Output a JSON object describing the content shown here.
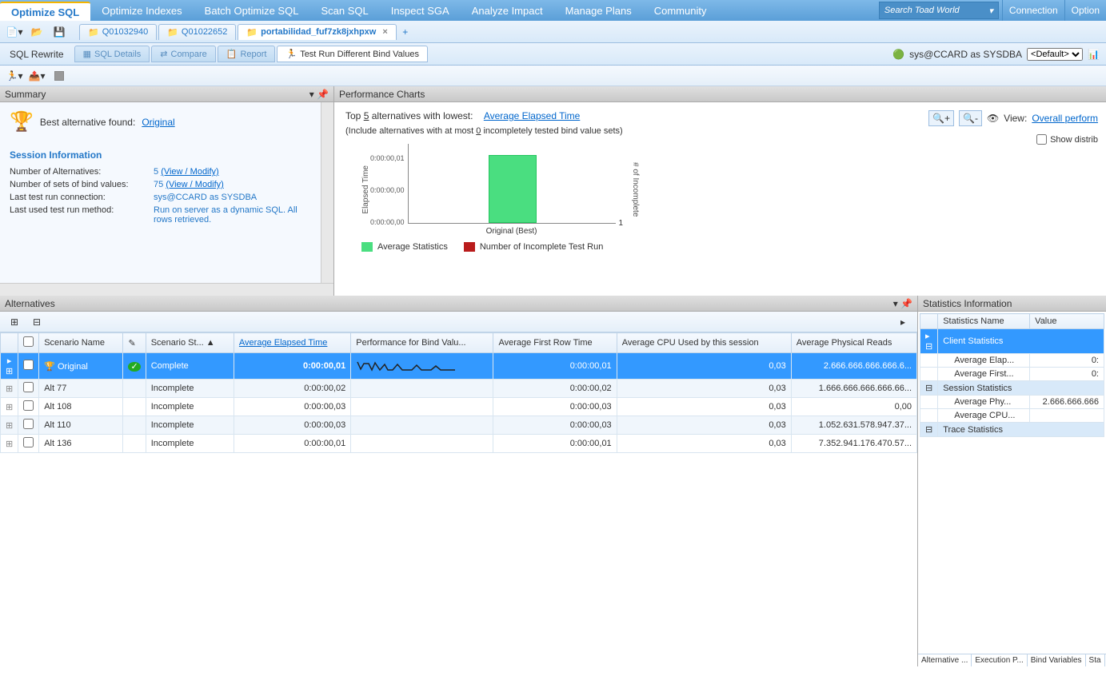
{
  "top_nav": {
    "tabs": [
      "Optimize SQL",
      "Optimize Indexes",
      "Batch Optimize SQL",
      "Scan SQL",
      "Inspect SGA",
      "Analyze Impact",
      "Manage Plans",
      "Community"
    ],
    "search_placeholder": "Search Toad World",
    "connection": "Connection",
    "options": "Option"
  },
  "doc_tabs": [
    "Q01032940",
    "Q01022652",
    "portabilidad_fuf7zk8jxhpxw"
  ],
  "sub_nav": {
    "rewrite": "SQL Rewrite",
    "tabs": [
      "SQL Details",
      "Compare",
      "Report",
      "Test Run Different Bind Values"
    ],
    "conn_text": "sys@CCARD as SYSDBA",
    "conn_select": "<Default>"
  },
  "summary": {
    "title": "Summary",
    "best_label": "Best alternative found:",
    "best_link": "Original",
    "session_title": "Session Information",
    "rows": [
      {
        "lbl": "Number of Alternatives:",
        "val": "5",
        "link": "(View / Modify)"
      },
      {
        "lbl": "Number of sets of bind values:",
        "val": "75",
        "link": "(View / Modify)"
      },
      {
        "lbl": "Last test run connection:",
        "val": "sys@CCARD as SYSDBA",
        "link": ""
      },
      {
        "lbl": "Last used test run method:",
        "val": "Run on server as a dynamic SQL. All rows retrieved.",
        "link": ""
      }
    ]
  },
  "charts": {
    "title": "Performance Charts",
    "filter_top": "Top",
    "filter_top_n": "5",
    "filter_text": "alternatives with lowest:",
    "filter_metric": "Average Elapsed Time",
    "include_text1": "(Include alternatives with at most",
    "include_n": "0",
    "include_text2": "incompletely tested bind value sets)",
    "view_label": "View:",
    "view_link": "Overall perform",
    "show_distrib": "Show distrib",
    "y_label": "Elapsed Time",
    "y_ticks": [
      "0:00:00,01",
      "0:00:00,00",
      "0:00:00,00"
    ],
    "x_label": "Original (Best)",
    "right_label": "# of Incomplete",
    "right_tick": "1",
    "legend": [
      {
        "color": "#4ade80",
        "text": "Average Statistics"
      },
      {
        "color": "#b91c1c",
        "text": "Number of Incomplete Test Run"
      }
    ]
  },
  "chart_data": {
    "type": "bar",
    "categories": [
      "Original (Best)"
    ],
    "series": [
      {
        "name": "Average Statistics",
        "values": [
          0.01
        ],
        "axis": "left"
      },
      {
        "name": "Number of Incomplete Test Run",
        "values": [
          0
        ],
        "axis": "right"
      }
    ],
    "ylabel_left": "Elapsed Time",
    "ylabel_right": "# of Incomplete",
    "ylim_left": [
      0,
      0.01
    ],
    "yticks_left": [
      "0:00:00,00",
      "0:00:00,00",
      "0:00:00,01"
    ],
    "ylim_right": [
      0,
      1
    ]
  },
  "alternatives": {
    "title": "Alternatives",
    "columns": [
      "",
      "",
      "Scenario Name",
      "",
      "Scenario St...",
      "Average Elapsed Time",
      "Performance for Bind Valu...",
      "Average First Row Time",
      "Average CPU Used by this session",
      "Average Physical Reads"
    ],
    "rows": [
      {
        "sel": true,
        "name": "Original",
        "status": "Complete",
        "elapsed": "0:00:00,01",
        "firstrow": "0:00:00,01",
        "cpu": "0,03",
        "reads": "2.666.666.666.666.6...",
        "check": true
      },
      {
        "sel": false,
        "name": "Alt 77",
        "status": "Incomplete",
        "elapsed": "0:00:00,02",
        "firstrow": "0:00:00,02",
        "cpu": "0,03",
        "reads": "1.666.666.666.666.66..."
      },
      {
        "sel": false,
        "name": "Alt 108",
        "status": "Incomplete",
        "elapsed": "0:00:00,03",
        "firstrow": "0:00:00,03",
        "cpu": "0,03",
        "reads": "0,00"
      },
      {
        "sel": false,
        "name": "Alt 110",
        "status": "Incomplete",
        "elapsed": "0:00:00,03",
        "firstrow": "0:00:00,03",
        "cpu": "0,03",
        "reads": "1.052.631.578.947.37..."
      },
      {
        "sel": false,
        "name": "Alt 136",
        "status": "Incomplete",
        "elapsed": "0:00:00,01",
        "firstrow": "0:00:00,01",
        "cpu": "0,03",
        "reads": "7.352.941.176.470.57..."
      }
    ]
  },
  "statistics": {
    "title": "Statistics Information",
    "headers": [
      "Statistics Name",
      "Value"
    ],
    "groups": [
      {
        "name": "Client Statistics",
        "rows": [
          {
            "n": "Average Elap...",
            "v": "0:"
          },
          {
            "n": "Average First...",
            "v": "0:"
          }
        ]
      },
      {
        "name": "Session Statistics",
        "rows": [
          {
            "n": "Average Phy...",
            "v": "2.666.666.666"
          },
          {
            "n": "Average CPU...",
            "v": ""
          }
        ]
      },
      {
        "name": "Trace Statistics",
        "rows": []
      }
    ],
    "bottom_tabs": [
      "Alternative ...",
      "Execution P...",
      "Bind Variables",
      "Sta"
    ]
  }
}
